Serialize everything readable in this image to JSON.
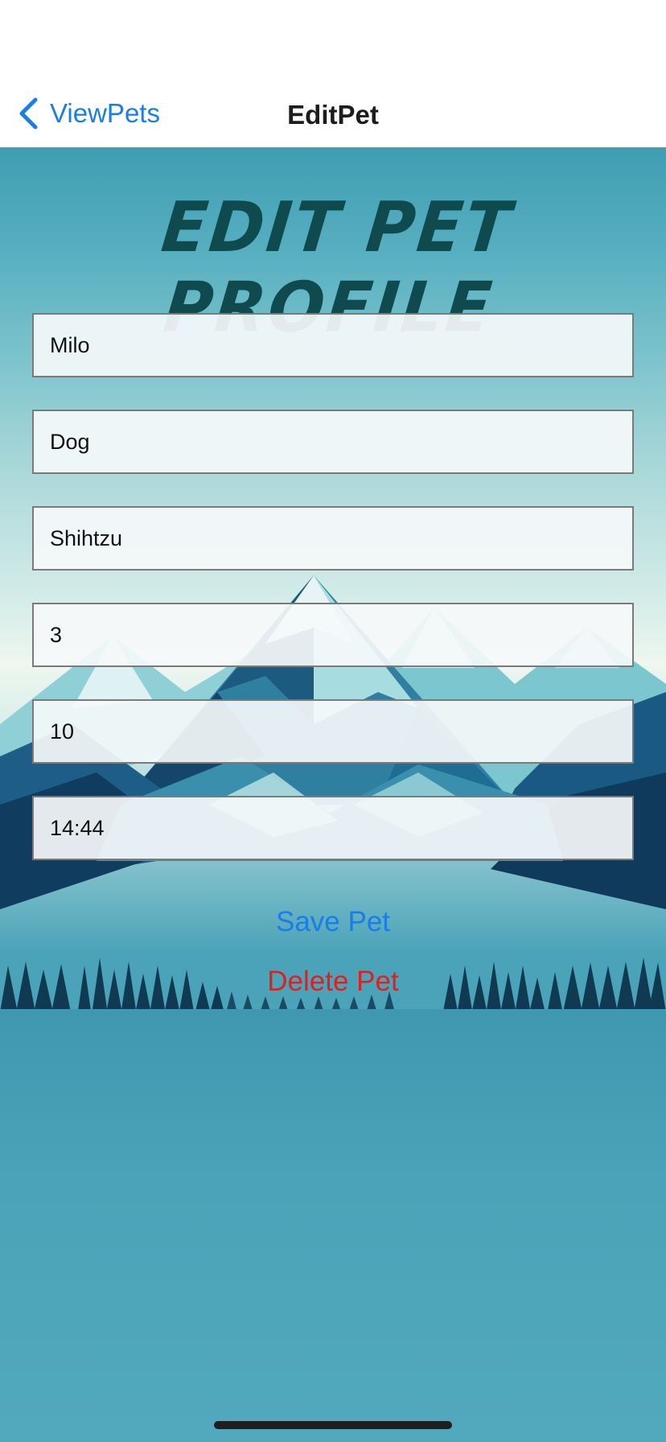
{
  "nav": {
    "back_label": "ViewPets",
    "title": "EditPet"
  },
  "page": {
    "title": "Edit Pet Profile"
  },
  "form": {
    "name": "Milo",
    "species": "Dog",
    "breed": "Shihtzu",
    "age": "3",
    "weight": "10",
    "time": "14:44"
  },
  "actions": {
    "save_label": "Save Pet",
    "delete_label": "Delete Pet"
  },
  "icons": {
    "back": "chevron-left-icon"
  },
  "colors": {
    "accent": "#1a7ee6",
    "destructive": "#e02020",
    "title": "#0e4a4e"
  }
}
